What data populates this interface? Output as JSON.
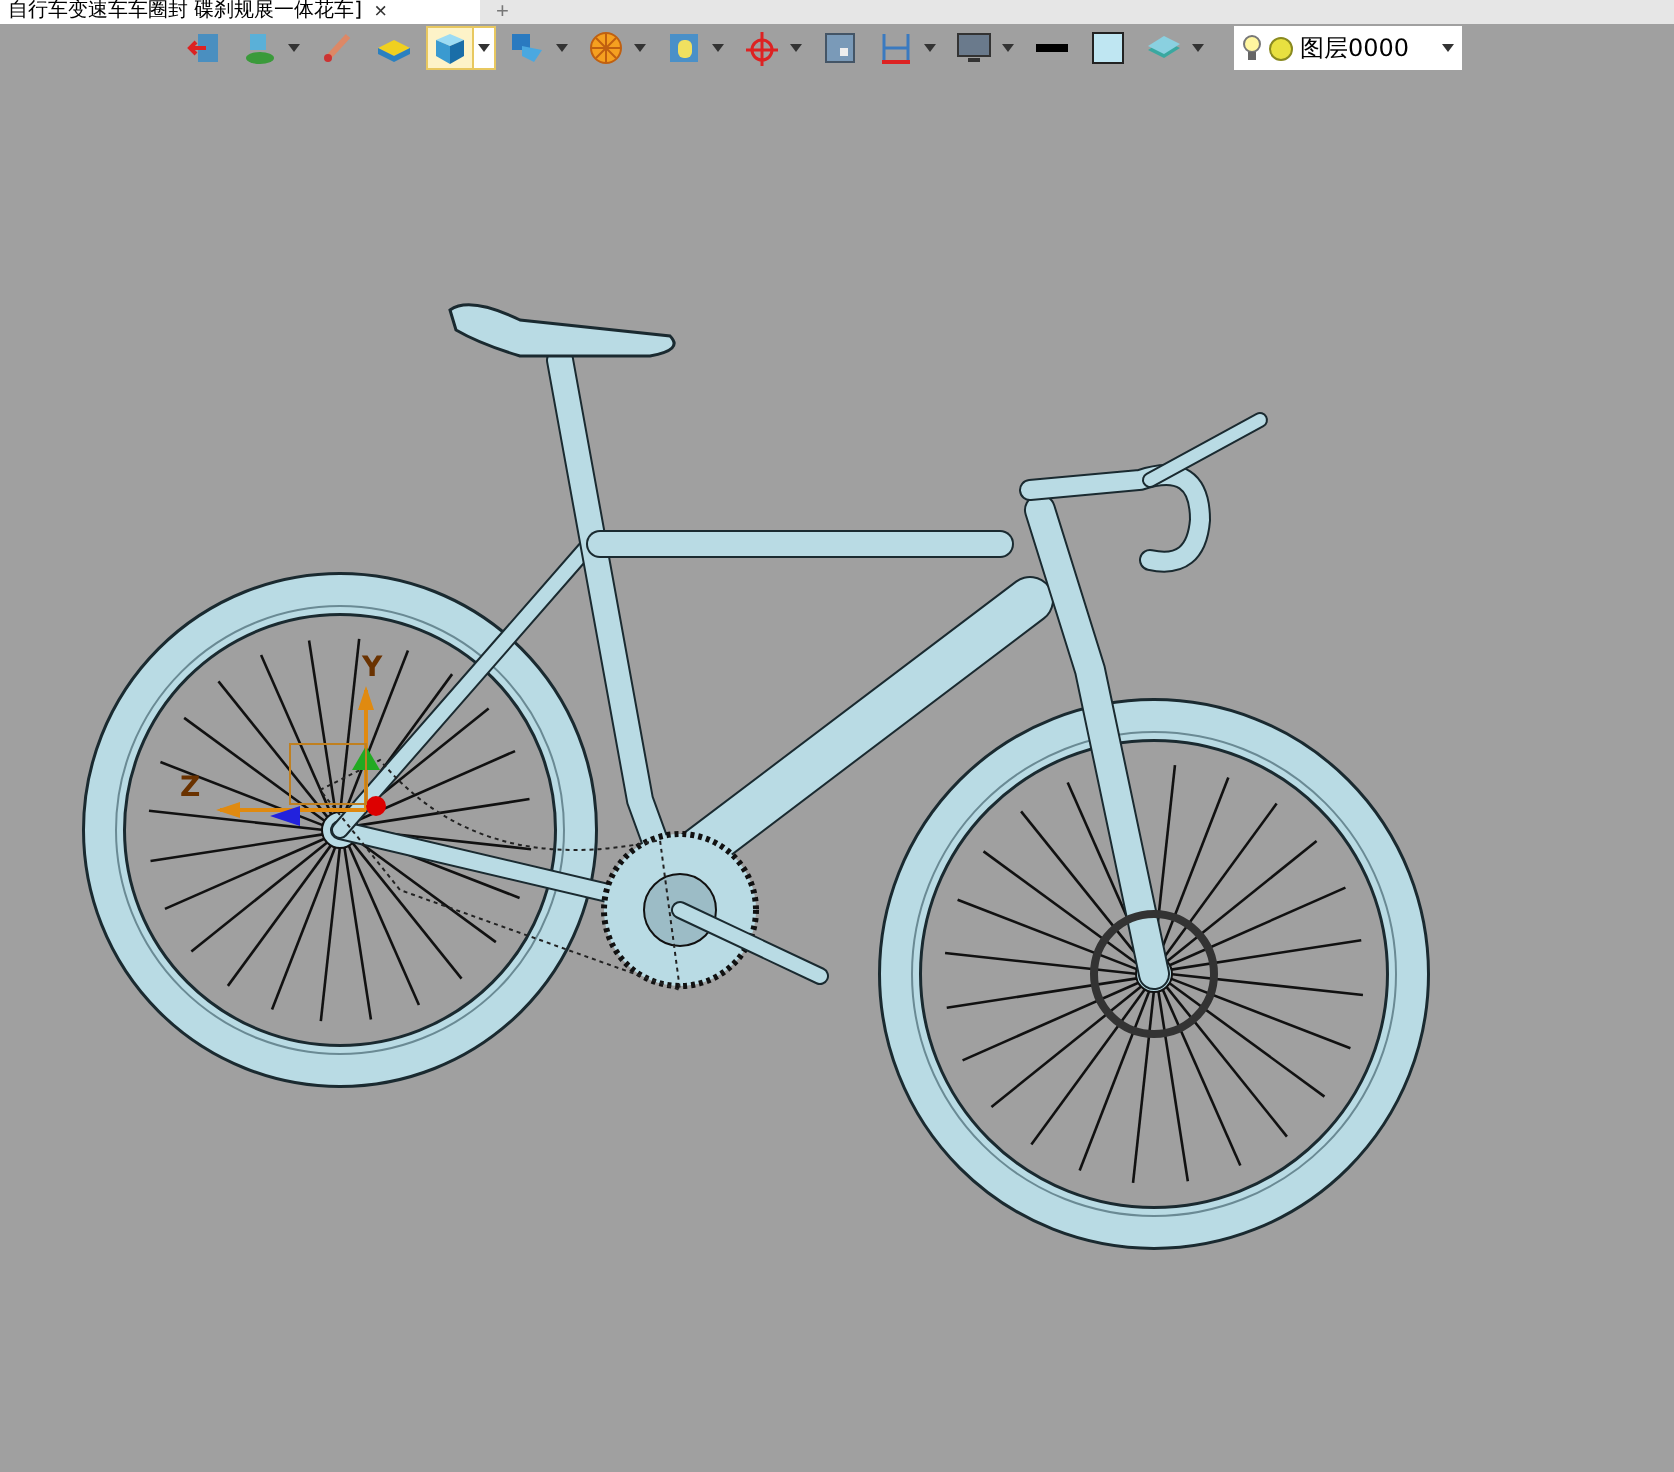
{
  "tab": {
    "title": "自行车变速车车圈封 碟刹规展一体花车]",
    "close": "×",
    "new_tab": "+"
  },
  "toolbar": {
    "buttons": [
      {
        "kind": "exit",
        "dropdown": false,
        "selected": false
      },
      {
        "kind": "paint",
        "dropdown": true,
        "selected": false
      },
      {
        "kind": "brush",
        "dropdown": false,
        "selected": false
      },
      {
        "kind": "box",
        "dropdown": false,
        "selected": false
      },
      {
        "kind": "cube",
        "dropdown": true,
        "selected": true
      },
      {
        "kind": "view",
        "dropdown": true,
        "selected": false
      },
      {
        "kind": "wheel",
        "dropdown": true,
        "selected": false
      },
      {
        "kind": "frame",
        "dropdown": true,
        "selected": false
      },
      {
        "kind": "target",
        "dropdown": true,
        "selected": false
      },
      {
        "kind": "square",
        "dropdown": false,
        "selected": false
      },
      {
        "kind": "measure",
        "dropdown": true,
        "selected": false
      },
      {
        "kind": "monitor",
        "dropdown": true,
        "selected": false
      },
      {
        "kind": "line",
        "dropdown": false,
        "selected": false
      },
      {
        "kind": "fill",
        "dropdown": false,
        "selected": false
      },
      {
        "kind": "layers",
        "dropdown": true,
        "selected": false
      }
    ],
    "layer": {
      "name": "图层0000"
    }
  },
  "viewport": {
    "axes": [
      {
        "label": "Y"
      },
      {
        "label": "Z"
      }
    ]
  }
}
